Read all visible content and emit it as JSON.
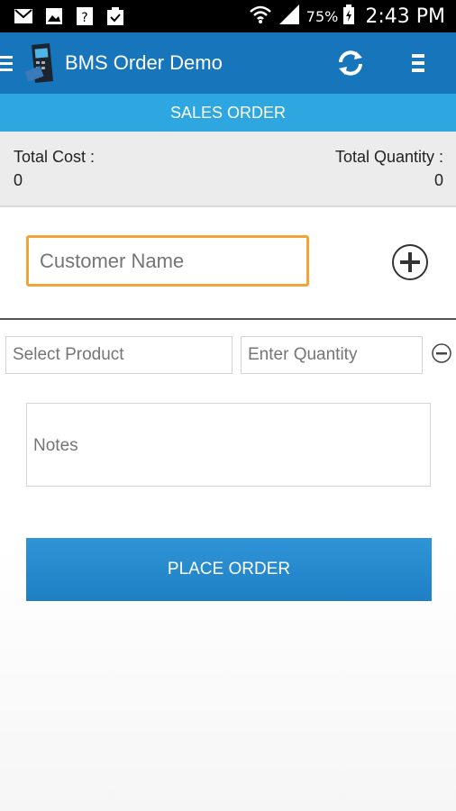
{
  "status_bar": {
    "battery": "75%",
    "time": "2:43 PM",
    "icons": [
      "mail-icon",
      "image-icon",
      "unknown-file-icon",
      "clipboard-check-icon",
      "wifi-icon",
      "signal-icon",
      "battery-icon"
    ]
  },
  "app_bar": {
    "title": "BMS Order Demo",
    "icons": [
      "menu-icon",
      "card-terminal-icon",
      "refresh-icon",
      "overflow-menu-icon"
    ],
    "color": "#1775bb"
  },
  "section": {
    "title": "SALES ORDER",
    "color": "#2ea7e0"
  },
  "totals": {
    "cost_label": "Total Cost :",
    "cost_value": "0",
    "quantity_label": "Total Quantity :",
    "quantity_value": "0"
  },
  "form": {
    "customer_placeholder": "Customer Name",
    "product_placeholder": "Select Product",
    "quantity_placeholder": "Enter Quantity",
    "notes_placeholder": "Notes",
    "accent_color": "#f0a43a"
  },
  "actions": {
    "place_order_label": "PLACE ORDER"
  }
}
